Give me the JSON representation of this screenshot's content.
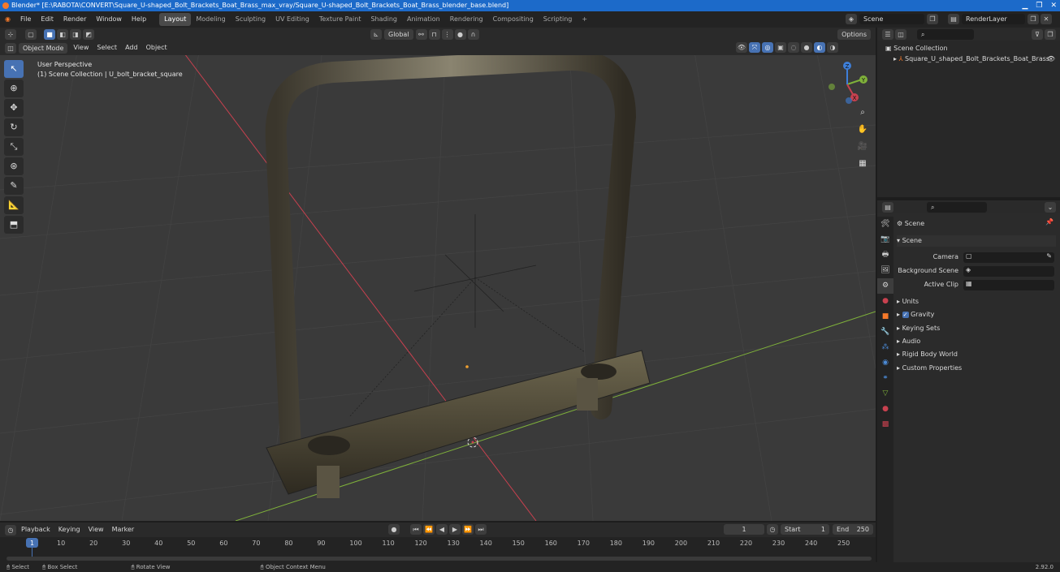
{
  "titlebar": {
    "title": "Blender* [E:\\RABOTA\\CONVERT\\Square_U-shaped_Bolt_Brackets_Boat_Brass_max_vray/Square_U-shaped_Bolt_Brackets_Boat_Brass_blender_base.blend]"
  },
  "menu": [
    "File",
    "Edit",
    "Render",
    "Window",
    "Help"
  ],
  "workspaces": [
    "Layout",
    "Modeling",
    "Sculpting",
    "UV Editing",
    "Texture Paint",
    "Shading",
    "Animation",
    "Rendering",
    "Compositing",
    "Scripting"
  ],
  "active_workspace": "Layout",
  "scene_field": "Scene",
  "renderlayer_field": "RenderLayer",
  "viewport": {
    "transform_orientation": "Global",
    "mode": "Object Mode",
    "menus": [
      "View",
      "Select",
      "Add",
      "Object"
    ],
    "options_label": "Options",
    "overlay_line1": "User Perspective",
    "overlay_line2": "(1) Scene Collection | U_bolt_bracket_square",
    "axis_x": "X",
    "axis_y": "Y",
    "axis_z": "Z"
  },
  "outliner": {
    "root": "Scene Collection",
    "items": [
      {
        "label": "Square_U_shaped_Bolt_Brackets_Boat_Brass"
      }
    ]
  },
  "properties": {
    "header": "Scene",
    "panel": "Scene",
    "fields": {
      "camera": "Camera",
      "background_scene": "Background Scene",
      "active_clip": "Active Clip"
    },
    "sections": [
      "Units",
      "Gravity",
      "Keying Sets",
      "Audio",
      "Rigid Body World",
      "Custom Properties"
    ]
  },
  "timeline": {
    "menus": [
      "Playback",
      "Keying",
      "View",
      "Marker"
    ],
    "current_frame": "1",
    "start_label": "Start",
    "start": "1",
    "end_label": "End",
    "end": "250",
    "ticks": [
      "1",
      "10",
      "20",
      "30",
      "40",
      "50",
      "60",
      "70",
      "80",
      "90",
      "100",
      "110",
      "120",
      "130",
      "140",
      "150",
      "160",
      "170",
      "180",
      "190",
      "200",
      "210",
      "220",
      "230",
      "240",
      "250"
    ]
  },
  "statusbar": {
    "items": [
      "Select",
      "Box Select",
      "Rotate View",
      "Object Context Menu"
    ],
    "version": "2.92.0"
  },
  "colors": {
    "accent": "#4772b3",
    "x_axis": "#c8414f",
    "y_axis": "#7fb13a",
    "z_axis": "#3e7fd9"
  }
}
